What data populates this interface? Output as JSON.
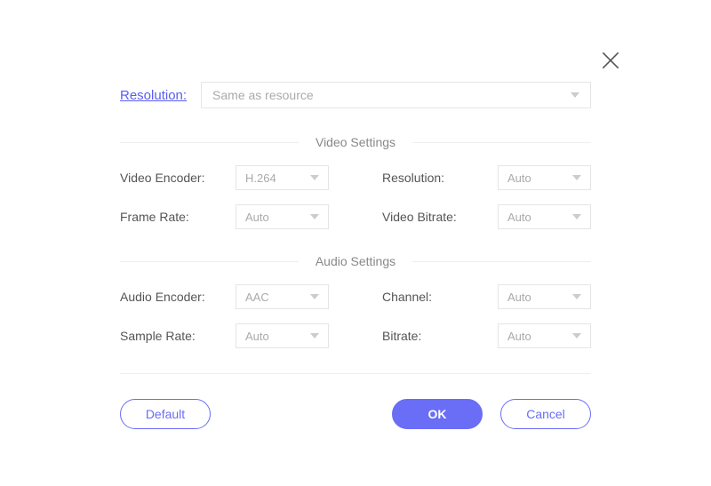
{
  "top": {
    "resolution_label": "Resolution:",
    "resolution_value": "Same as resource"
  },
  "sections": {
    "video_title": "Video Settings",
    "audio_title": "Audio Settings"
  },
  "video": {
    "encoder_label": "Video Encoder:",
    "encoder_value": "H.264",
    "resolution_label": "Resolution:",
    "resolution_value": "Auto",
    "framerate_label": "Frame Rate:",
    "framerate_value": "Auto",
    "bitrate_label": "Video Bitrate:",
    "bitrate_value": "Auto"
  },
  "audio": {
    "encoder_label": "Audio Encoder:",
    "encoder_value": "AAC",
    "channel_label": "Channel:",
    "channel_value": "Auto",
    "samplerate_label": "Sample Rate:",
    "samplerate_value": "Auto",
    "bitrate_label": "Bitrate:",
    "bitrate_value": "Auto"
  },
  "buttons": {
    "default": "Default",
    "ok": "OK",
    "cancel": "Cancel"
  }
}
